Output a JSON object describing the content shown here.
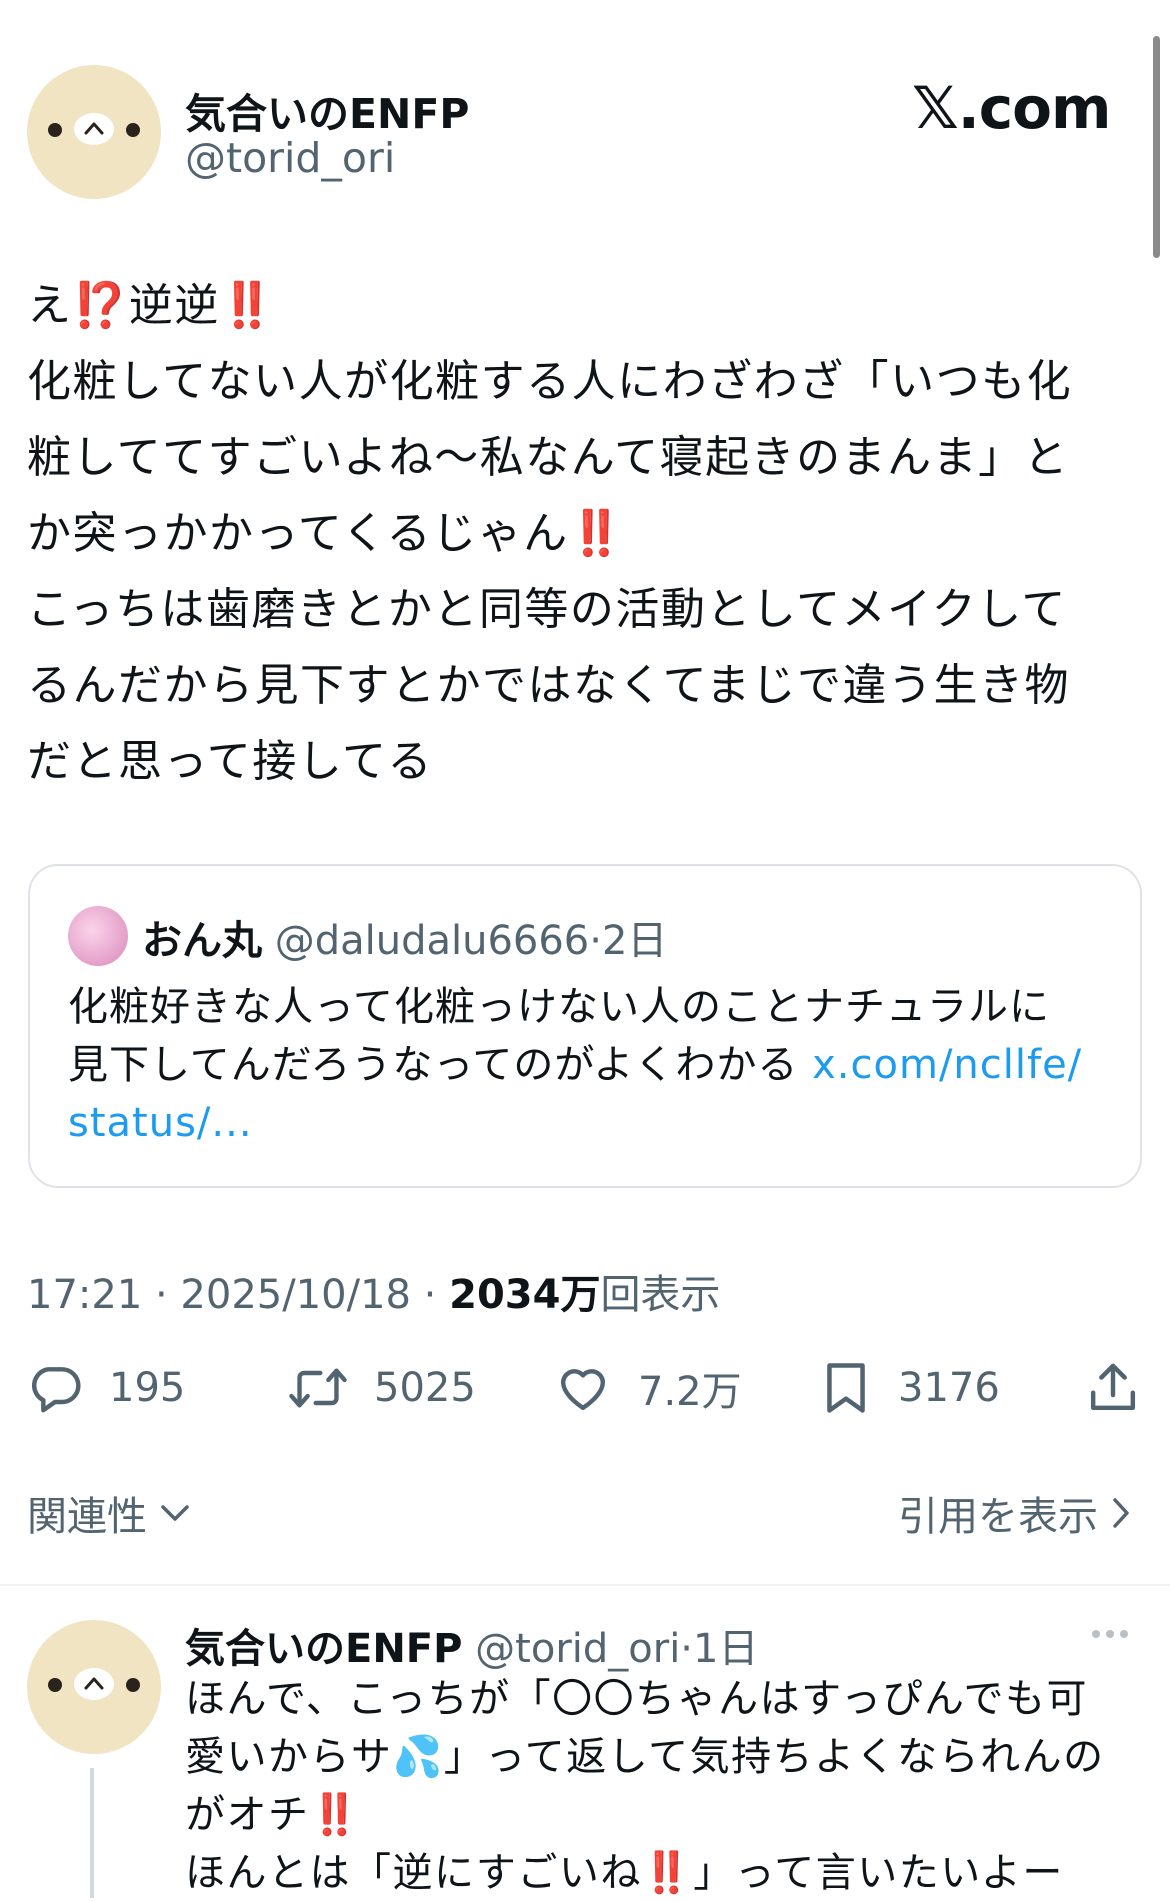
{
  "post": {
    "display_name": "気合いのENFP",
    "handle": "@torid_ori",
    "site_logo": "𝕏.com",
    "body_lines": [
      [
        "え",
        "⁉️",
        "逆逆",
        "‼️"
      ],
      [
        "化粧してない人が化粧する人にわざわざ「いつも化"
      ],
      [
        "粧しててすごいよね〜私なんて寝起きのまんま」と"
      ],
      [
        "か突っかかってくるじゃん",
        "‼️"
      ],
      [
        "こっちは歯磨きとかと同等の活動としてメイクして"
      ],
      [
        "るんだから見下すとかではなくてまじで違う生き物"
      ],
      [
        "だと思って接してる"
      ]
    ],
    "quote": {
      "display_name": "おん丸",
      "handle_and_time": "@daludalu6666·2日",
      "text_line1": "化粧好きな人って化粧っけない人のことナチュラルに",
      "text_line2": "見下してんだろうなってのがよくわかる",
      "link_part1": "x.com/ncllfe/",
      "link_part2": "status/..."
    },
    "timestamp": "17:21 · 2025/10/18 · ",
    "views_count": "2034万",
    "views_label": "回表示",
    "actions": {
      "replies": "195",
      "reposts": "5025",
      "likes": "7.2万",
      "bookmarks": "3176"
    }
  },
  "sort": {
    "label": "関連性"
  },
  "quotes_link": {
    "label": "引用を表示"
  },
  "reply": {
    "display_name": "気合いのENFP",
    "handle_and_time": " @torid_ori·1日",
    "body_lines": [
      [
        "ほんで、こっちが「〇〇ちゃんはすっぴんでも可"
      ],
      [
        "愛いからサ",
        "💦",
        "」って返して気持ちよくなられんの"
      ],
      [
        "がオチ",
        "‼️"
      ],
      [
        "ほんとは「逆にすごいね",
        "‼️",
        "」って言いたいよー"
      ]
    ]
  },
  "colors": {
    "text": "#0f1419",
    "muted": "#536471",
    "link": "#1d9bf0",
    "emoji_red": "#dd2e44",
    "avatar_bg": "#f1e4c2"
  }
}
